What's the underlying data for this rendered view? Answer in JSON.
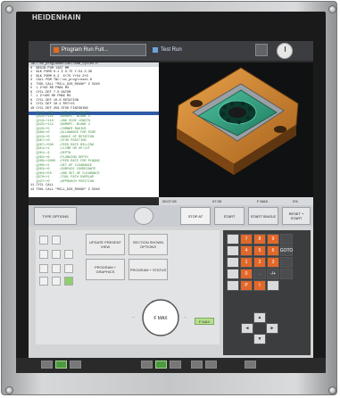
{
  "brand": "HEIDENHAIN",
  "tabs": [
    {
      "label": "Program Run Full..."
    },
    {
      "label": "Test Run"
    }
  ],
  "program": {
    "path": "TNC:\\nc_prog\\demo\\1367\\Rem_Cycles.H",
    "lines": [
      {
        "text": "0  BEGIN PGM 1367 MM"
      },
      {
        "text": "1  BLK FORM 0.1 Z X-75 Y-54 Z-30"
      },
      {
        "text": "2  BLK FORM 0.2  X+75 Y+54 Z+0"
      },
      {
        "text": "3  CALL PGM TNC:\\nc_prog\\reset.H"
      },
      {
        "text": "4  TOOL CALL \"MILL_D20_ROUGH\" Z S340"
      },
      {
        "text": "5  L Z+50 R0 FMAX M3"
      },
      {
        "text": "6  CYCL DEF 7.0 DATUM"
      },
      {
        "text": "7  L Z+100 R0 FMAX M3"
      },
      {
        "text": "8  CYCL DEF 10.0 ROTATION"
      },
      {
        "text": "9  CYCL DEF 10.1 ROT+15"
      },
      {
        "text": "10 CYCL DEF 256 STUD FINISHING"
      },
      {
        "text": "   Q218=+150   ;1ST SIDE LENGTH"
      },
      {
        "text": "   Q424=+152   ;WORKPC. BLANK 1"
      },
      {
        "text": "   Q219=+110   ;2ND SIDE LENGTH"
      },
      {
        "text": "   Q425=+112   ;WORKPC. BLANK 2"
      },
      {
        "text": "   Q220=+5     ;CORNER RADIUS"
      },
      {
        "text": "   Q368=+0     ;ALLOWANCE FOR SIDE"
      },
      {
        "text": "   Q224=+0     ;ANGLE OF ROTATION"
      },
      {
        "text": "   Q367=+0     ;STUD POSITION"
      },
      {
        "text": "   Q207=+500   ;FEED RATE MILLING"
      },
      {
        "text": "   Q351=+1     ;CLIMB OR UP-CUT"
      },
      {
        "text": "   Q201=-6     ;DEPTH"
      },
      {
        "text": "   Q202=+6     ;PLUNGING DEPTH"
      },
      {
        "text": "   Q206=+3000  ;FEED RATE FOR PLNGNG"
      },
      {
        "text": "   Q200=+2     ;SET-UP CLEARANCE"
      },
      {
        "text": "   Q203=+0     ;SURFACE COORDINATE"
      },
      {
        "text": "   Q204=+50    ;2ND SET-UP CLEARANCE"
      },
      {
        "text": "   Q370=+1     ;TOOL PATH OVERLAP"
      },
      {
        "text": "   Q437=+0     ;APPROACH POSITION"
      },
      {
        "text": "11 CYCL CALL"
      },
      {
        "text": "12 TOOL CALL \"MILL_D20_ROUGH\" Z S340"
      }
    ]
  },
  "viewbar": {
    "t1": "00:07:28",
    "t2": "07:35",
    "t3": "F MAX",
    "pct": "0%"
  },
  "status": {
    "type_label": "TYPE OPTIONS",
    "stop_label": "STOP AT",
    "start_label": "START",
    "start_single_label": "START SINGLE",
    "reset_label": "RESET + START"
  },
  "lower": {
    "label_a": "FN\nON",
    "btn_update": "UPDATE PRESENT VIEW",
    "btn_section": "SECTION SHOWN OPTIONS",
    "btn_program": "PROGRAM + GRAPHICS",
    "btn_program2": "PROGRAM + STATUS",
    "fmax": "F MAX",
    "pot_label": "F MAX",
    "keys": [
      "7",
      "8",
      "9",
      "4",
      "5",
      "6",
      "1",
      "2",
      "3",
      "0",
      ".",
      "-/+",
      "P",
      "I",
      "",
      "",
      "GOTO",
      "",
      ""
    ],
    "key_labels": [
      "Q",
      "GOTO",
      "END",
      "DEL",
      "NO ENT",
      "ENT"
    ]
  },
  "colors": {
    "accent": "#e2682a",
    "green": "#4c9a3e",
    "selection": "#2f5aa8"
  }
}
